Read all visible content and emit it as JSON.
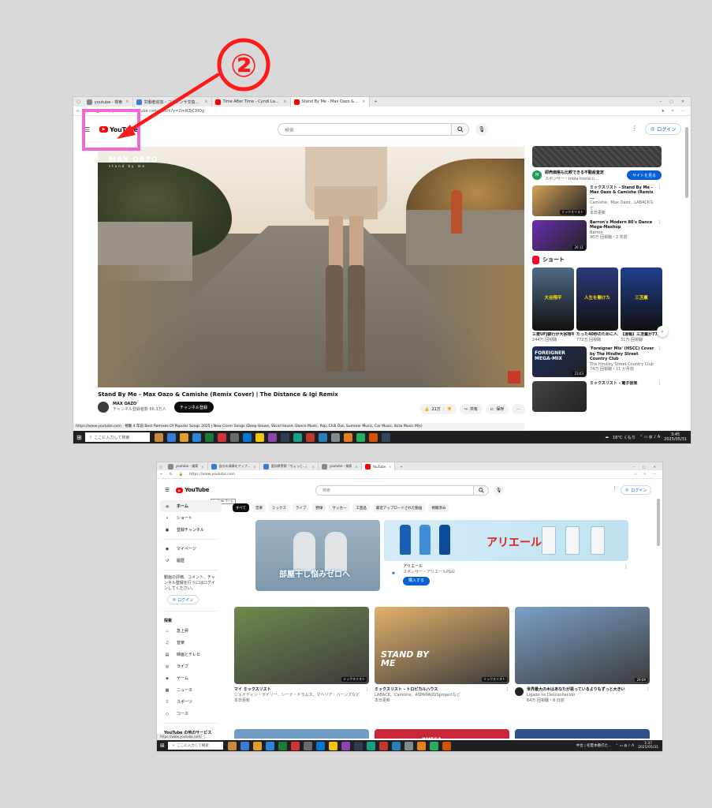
{
  "annotation": {
    "step_number": "②"
  },
  "shot1": {
    "tabs": [
      {
        "label": "youtube - 検索",
        "color": "#888888"
      },
      {
        "label": "労働者追加・コンデンサ交換を完了しました",
        "color": "#3a7bd5"
      },
      {
        "label": "Time After Time - Cyndi Lauper I...",
        "color": "#ff0000"
      },
      {
        "label": "Stand By Me - Max Oazo & C...",
        "color": "#ff0000",
        "active": true
      }
    ],
    "url": "https://www.youtube.com/watch?v=ZmIKBjCMOg",
    "logo_text": "YouTube",
    "search_placeholder": "検索",
    "login_label": "ログイン",
    "player": {
      "brand_line1": "MAX OAZO",
      "brand_line2": "stand by me"
    },
    "video_title": "Stand By Me - Max Oazo & Camishe (Remix Cover) | The Distance & Igi Remix",
    "channel_name": "MAX OAZO",
    "subscribers": "チャンネル登録者数 66.3万人",
    "subscribe_label": "チャンネル登録",
    "like_count": "21万",
    "share_label": "共有",
    "save_label": "保存",
    "status_url": "https://www.youtube.com",
    "description": "視聴 4 年前 Best Remixes Of Popular Songs 2025 | New Cover Songs (Deep House, Vocal House, Dance Music, Pop, Chill Out, Summer Music, Car Music, Ibiza Music Mix)",
    "ad": {
      "title": "即売価格も比較できる不動産査定",
      "sponsor": "スポンサー・mola-home.n...",
      "button": "サイトを見る"
    },
    "recs": [
      {
        "title": "ミックスリスト - Stand By Me - Max Oazo & Camishe (Remix ...",
        "sub1": "Camishe、Max Oazo、LABACKなど",
        "sub2": "本日更新",
        "badge": "ミックスリスト",
        "color": "#d7a15a"
      },
      {
        "title": "Barron's Modern 80's Dance Mega-Mashup",
        "sub1": "Barron",
        "sub2": "90万 回視聴・2 年前",
        "badge": "26:11",
        "color": "#6b2fb0"
      }
    ],
    "shorts_label": "ショート",
    "shorts": [
      {
        "title": "三菱UFJ銀行が大谷翔平...",
        "views": "244万 回視聴",
        "caption": "大谷翔平",
        "color": "#4d6b86"
      },
      {
        "title": "たった40秒のために人...",
        "views": "772万 回視聴",
        "caption": "人生を懸けた",
        "color": "#2c3a7a"
      },
      {
        "title": "【速報】三苫薫が77億...",
        "views": "31万 回視聴",
        "caption": "三苫薫",
        "color": "#1f3f8f"
      }
    ],
    "recs2": [
      {
        "title": "'Foreigner Mix' (HSCC) Cover by The Hindley Street Country Club",
        "sub1": "The Hindley Street Country Club",
        "sub2": "74万 回視聴・11 か月前",
        "badge": "23:03",
        "color": "#1a2c5c",
        "caption": "FOREIGNER MEGA-MIX"
      },
      {
        "title": "ミックスリスト - 電子音楽",
        "sub1": "",
        "sub2": "",
        "badge": "",
        "color": "#444444"
      }
    ],
    "taskbar": {
      "search": "ここに入力して検索",
      "weather": "18°C くもり",
      "time": "3:45",
      "date": "2025/05/31"
    }
  },
  "shot2": {
    "tabs": [
      {
        "label": "youtube - 検索",
        "color": "#888888"
      },
      {
        "label": "自分の演奏をアップ...",
        "color": "#3a7bd5"
      },
      {
        "label": "愛知県警察「ちょっと...」",
        "color": "#3a7bd5"
      },
      {
        "label": "youtube - 検索",
        "color": "#888888"
      },
      {
        "label": "YouTube",
        "color": "#ff0000",
        "active": true
      }
    ],
    "url": "https://www.youtube.com",
    "logo_text": "YouTube",
    "logo_tooltip": "YouTube ホーム",
    "search_placeholder": "検索",
    "login_label": "ログイン",
    "sidebar": {
      "top": [
        {
          "label": "ホーム",
          "icon": "⌂",
          "selected": true
        },
        {
          "label": "ショート",
          "icon": "⚡"
        },
        {
          "label": "登録チャンネル",
          "icon": "▣"
        }
      ],
      "mid": [
        {
          "label": "マイページ",
          "icon": "◉"
        },
        {
          "label": "履歴",
          "icon": "↺"
        }
      ],
      "note": "動画の評価、コメント、チャンネル登録を行うにはログインしてください。",
      "login_label": "ログイン",
      "explore_title": "探索",
      "explore": [
        {
          "label": "急上昇",
          "icon": "♨"
        },
        {
          "label": "音楽",
          "icon": "♫"
        },
        {
          "label": "映画とテレビ",
          "icon": "▤"
        },
        {
          "label": "ライブ",
          "icon": "◎"
        },
        {
          "label": "ゲーム",
          "icon": "◈"
        },
        {
          "label": "ニュース",
          "icon": "▦"
        },
        {
          "label": "スポーツ",
          "icon": "♖"
        },
        {
          "label": "コース",
          "icon": "◇"
        }
      ],
      "more_title": "YouTube の他のサービス"
    },
    "chips": [
      "すべて",
      "音楽",
      "ミックス",
      "ライブ",
      "野球",
      "サッカー",
      "工芸品",
      "最近アップロードされた動画",
      "視聴済み"
    ],
    "ad_left_caption": "部屋干し悩みゼロへ",
    "ad_right": {
      "brand": "アリエール",
      "title": "アリエール",
      "sponsor": "スポンサー・アリエールP&G",
      "button": "購入する"
    },
    "cards": [
      {
        "title": "マイ ミックスリスト",
        "sub1": "ジェイディン・ライリー、シーナ・ドラムス、マヘリア・バーンズなど",
        "sub2": "本日更新",
        "badge": "ミックスリスト",
        "color": "#6e8a4c"
      },
      {
        "title": "ミックスリスト - トロピカルハウス",
        "sub1": "LABACK、Camishe、ASPARAGUSprojectなど",
        "sub2": "本日更新",
        "badge": "ミックスリスト",
        "color": "#e2b06a",
        "caption": "STAND BY ME"
      },
      {
        "title": "世界最大の木はあなたが思っているよりもずっと大きい",
        "sub1": "Ligado no Desconhecido",
        "sub2": "64万 回視聴・8 日前",
        "badge": "29:09",
        "color": "#7aa0c9"
      }
    ],
    "row2_colors": [
      "#6e9ec4",
      "#c9263a",
      "#2f4f8a"
    ],
    "row2_caption": "OMEGA",
    "status_url": "https://www.youtube.com/",
    "taskbar": {
      "search": "ここに入力して検索",
      "weather": "中台 | 初夏本番打た...",
      "time": "1:37",
      "date": "2025/05/31"
    }
  }
}
